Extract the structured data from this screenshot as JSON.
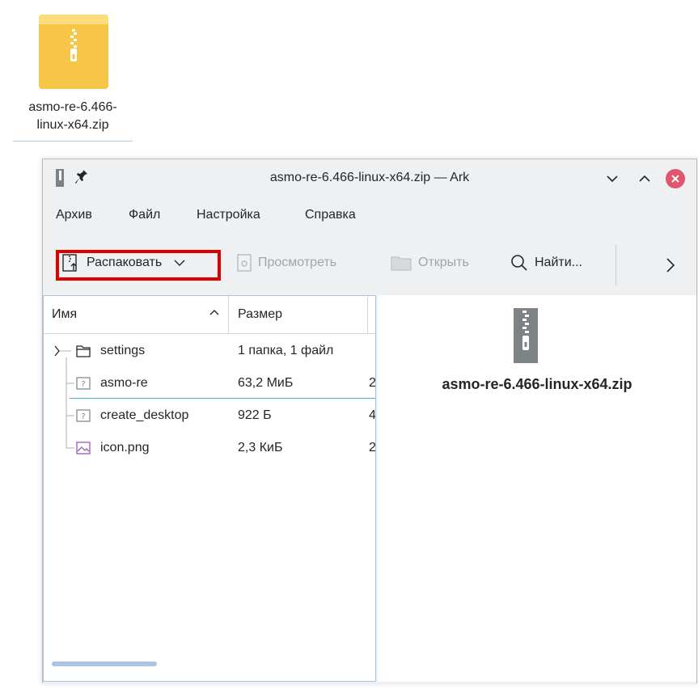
{
  "desktop": {
    "icon_name": "zip-archive-icon",
    "label_line1": "asmo-re-6.466-",
    "label_line2": "linux-x64.zip"
  },
  "window": {
    "title": "asmo-re-6.466-linux-x64.zip — Ark",
    "colors": {
      "close": "#e0566a",
      "highlight": "#e00000",
      "selection": "#3daee9"
    }
  },
  "menu": [
    "Архив",
    "Файл",
    "Настройка",
    "Справка"
  ],
  "toolbar": {
    "extract": "Распаковать",
    "preview": "Просмотреть",
    "open": "Открыть",
    "find": "Найти...",
    "more_icon": "chevron-right-icon"
  },
  "columns": {
    "name": "Имя",
    "size": "Размер"
  },
  "files": [
    {
      "name": "settings",
      "size": "1 папка, 1 файл",
      "extra": "",
      "icon": "folder-icon"
    },
    {
      "name": "asmo-re",
      "size": "63,2 МиБ",
      "extra": "2",
      "icon": "unknown-file-icon"
    },
    {
      "name": "create_desktop",
      "size": "922 Б",
      "extra": "4",
      "icon": "unknown-file-icon"
    },
    {
      "name": "icon.png",
      "size": "2,3 КиБ",
      "extra": "2",
      "icon": "image-file-icon"
    }
  ],
  "preview": {
    "filename": "asmo-re-6.466-linux-x64.zip"
  }
}
